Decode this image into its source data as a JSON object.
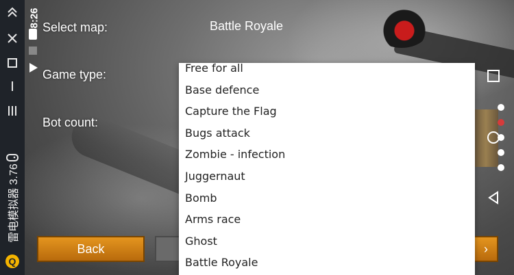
{
  "emulator": {
    "name": "雷电模拟器 3.76",
    "icons": [
      "chevrons-up-icon",
      "close-icon",
      "square-icon",
      "minimize-icon",
      "menu-icon",
      "gamepad-icon",
      "emulator-logo-icon"
    ]
  },
  "status_bar": {
    "time": "8:26"
  },
  "settings": {
    "select_map_label": "Select map:",
    "select_map_value": "Battle Royale",
    "game_type_label": "Game type:",
    "bot_count_label": "Bot count:"
  },
  "buttons": {
    "back_label": "Back",
    "next_label": "›"
  },
  "dropdown": {
    "options": [
      "Free for all",
      "Base defence",
      "Capture the Flag",
      "Bugs attack",
      "Zombie - infection",
      "Juggernaut",
      "Bomb",
      "Arms race",
      "Ghost",
      "Battle Royale"
    ]
  },
  "page_dots": {
    "count": 5,
    "active_index": 1
  },
  "colors": {
    "accent_button": "#d98414",
    "active_dot": "#d63b3b",
    "sidebar_bg": "#1f2329"
  }
}
